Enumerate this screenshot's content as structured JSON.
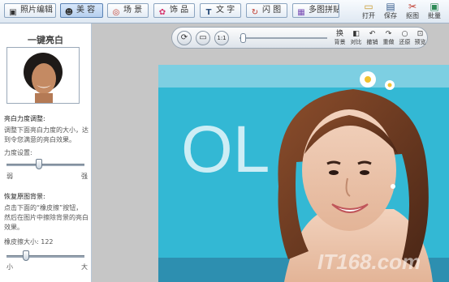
{
  "toolbar": {
    "tabs": [
      {
        "label": "照片编辑",
        "icon": "photo-edit-icon",
        "glyph": "▣",
        "active": false
      },
      {
        "label": "美 容",
        "icon": "beauty-face-icon",
        "glyph": "☻",
        "active": true
      },
      {
        "label": "场 景",
        "icon": "scene-icon",
        "glyph": "◎",
        "active": false
      },
      {
        "label": "饰 品",
        "icon": "bow-icon",
        "glyph": "✿",
        "active": false
      },
      {
        "label": "文 字",
        "icon": "text-icon",
        "glyph": "T",
        "active": false
      },
      {
        "label": "闪 图",
        "icon": "flash-icon",
        "glyph": "↻",
        "active": false
      },
      {
        "label": "多图拼贴",
        "icon": "collage-icon",
        "glyph": "▦",
        "active": false
      }
    ],
    "right_buttons": [
      {
        "label": "打开",
        "icon": "folder-open-icon",
        "glyph": "▭"
      },
      {
        "label": "保存",
        "icon": "save-icon",
        "glyph": "▤"
      },
      {
        "label": "抠图",
        "icon": "cutout-icon",
        "glyph": "✂"
      },
      {
        "label": "批量",
        "icon": "batch-icon",
        "glyph": "▣"
      }
    ]
  },
  "sidebar": {
    "title": "一键亮白",
    "brightness_heading": "亮白力度调整:",
    "brightness_desc": "调整下面亮白力度的大小，达到令您满意的亮白效果。",
    "strength_label": "力度设置:",
    "strength_min": "弱",
    "strength_max": "强",
    "strength_value": 0.42,
    "restore_heading": "恢复原图背景:",
    "restore_desc": "点击下面的“橡皮擦”按钮，然后在图片中擦除背景的亮白效果。",
    "eraser_label": "橡皮擦大小: 122",
    "eraser_min": "小",
    "eraser_max": "大",
    "eraser_value": 0.25
  },
  "photo_toolbar": {
    "zoom_value": 0.04,
    "buttons": [
      {
        "label": "背景",
        "icon": "background-icon",
        "glyph": "换"
      },
      {
        "label": "对比",
        "icon": "compare-icon",
        "glyph": "◧"
      },
      {
        "label": "撤销",
        "icon": "undo-icon",
        "glyph": "↶"
      },
      {
        "label": "重做",
        "icon": "redo-icon",
        "glyph": "↷"
      },
      {
        "label": "还原",
        "icon": "restore-icon",
        "glyph": "○"
      },
      {
        "label": "预览",
        "icon": "preview-icon",
        "glyph": "⊡"
      }
    ]
  },
  "photo": {
    "banner_text": "OL",
    "watermark": "IT168.com"
  },
  "colors": {
    "accent": "#4a78b5",
    "photo_bg": "#33b8d4"
  }
}
